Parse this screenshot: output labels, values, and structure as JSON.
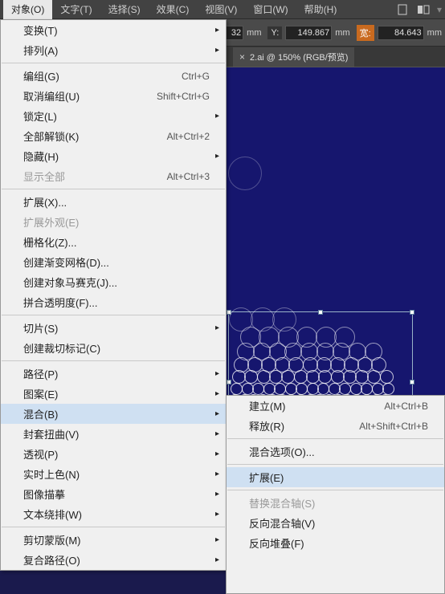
{
  "menubar": {
    "items": [
      "对象(O)",
      "文字(T)",
      "选择(S)",
      "效果(C)",
      "视图(V)",
      "窗口(W)",
      "帮助(H)"
    ]
  },
  "control": {
    "y_label": "Y:",
    "y_value": "149.867",
    "w_label": "宽:",
    "w_value": "84.643",
    "mm_suffix": "mm",
    "left_frag": "32",
    "left_unit": "mm"
  },
  "tab": {
    "title": "2.ai @ 150% (RGB/预览)",
    "close": "×"
  },
  "menu_main": [
    {
      "label": "变换(T)",
      "sub": true
    },
    {
      "label": "排列(A)",
      "sub": true
    },
    {
      "sep": true
    },
    {
      "label": "编组(G)",
      "shortcut": "Ctrl+G"
    },
    {
      "label": "取消编组(U)",
      "shortcut": "Shift+Ctrl+G"
    },
    {
      "label": "锁定(L)",
      "sub": true
    },
    {
      "label": "全部解锁(K)",
      "shortcut": "Alt+Ctrl+2"
    },
    {
      "label": "隐藏(H)",
      "sub": true
    },
    {
      "label": "显示全部",
      "shortcut": "Alt+Ctrl+3",
      "disabled": true
    },
    {
      "sep": true
    },
    {
      "label": "扩展(X)..."
    },
    {
      "label": "扩展外观(E)",
      "disabled": true
    },
    {
      "label": "栅格化(Z)..."
    },
    {
      "label": "创建渐变网格(D)..."
    },
    {
      "label": "创建对象马赛克(J)..."
    },
    {
      "label": "拼合透明度(F)..."
    },
    {
      "sep": true
    },
    {
      "label": "切片(S)",
      "sub": true
    },
    {
      "label": "创建裁切标记(C)"
    },
    {
      "sep": true
    },
    {
      "label": "路径(P)",
      "sub": true
    },
    {
      "label": "图案(E)",
      "sub": true
    },
    {
      "label": "混合(B)",
      "sub": true,
      "hl": true
    },
    {
      "label": "封套扭曲(V)",
      "sub": true
    },
    {
      "label": "透视(P)",
      "sub": true
    },
    {
      "label": "实时上色(N)",
      "sub": true
    },
    {
      "label": "图像描摹",
      "sub": true
    },
    {
      "label": "文本绕排(W)",
      "sub": true
    },
    {
      "sep": true
    },
    {
      "label": "剪切蒙版(M)",
      "sub": true
    },
    {
      "label": "复合路径(O)",
      "sub": true
    }
  ],
  "menu_sub": [
    {
      "label": "建立(M)",
      "shortcut": "Alt+Ctrl+B"
    },
    {
      "label": "释放(R)",
      "shortcut": "Alt+Shift+Ctrl+B"
    },
    {
      "sep": true
    },
    {
      "label": "混合选项(O)..."
    },
    {
      "sep": true
    },
    {
      "label": "扩展(E)",
      "hl": true
    },
    {
      "sep": true
    },
    {
      "label": "替换混合轴(S)",
      "disabled": true
    },
    {
      "label": "反向混合轴(V)"
    },
    {
      "label": "反向堆叠(F)"
    }
  ]
}
